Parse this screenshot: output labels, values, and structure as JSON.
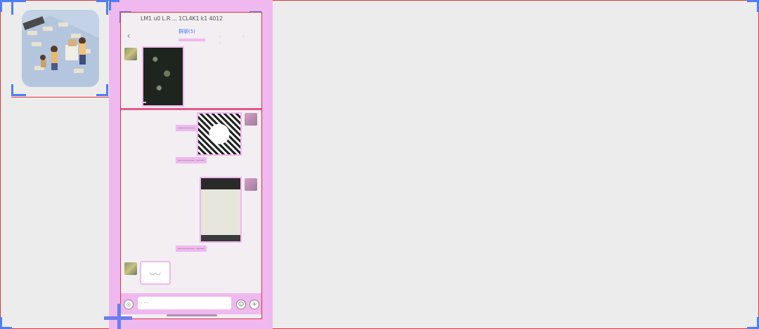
{
  "thumbnail": {
    "alt": "office illustration"
  },
  "chat": {
    "title": "LM1 u0 L.R ... 1CL4K1 k1 4012",
    "subtitle": "群聊(5)",
    "back": "‹",
    "menu": "· · ·",
    "messages": [
      {
        "side": "left",
        "type": "image",
        "label": ""
      },
      {
        "side": "right",
        "type": "image",
        "label": "————"
      },
      {
        "side": "right",
        "type": "text",
        "label": "———— ——"
      },
      {
        "side": "right",
        "type": "image",
        "label": "———— ——"
      },
      {
        "side": "left",
        "type": "sticker",
        "label": "◡◡"
      }
    ],
    "input_placeholder": "· · ·",
    "voice_glyph": "◎",
    "emoji_glyph": "☺",
    "plus_glyph": "+"
  },
  "colors": {
    "selection": "#efb8ef",
    "frame": "#e8323c",
    "accent": "#4f7df3"
  }
}
